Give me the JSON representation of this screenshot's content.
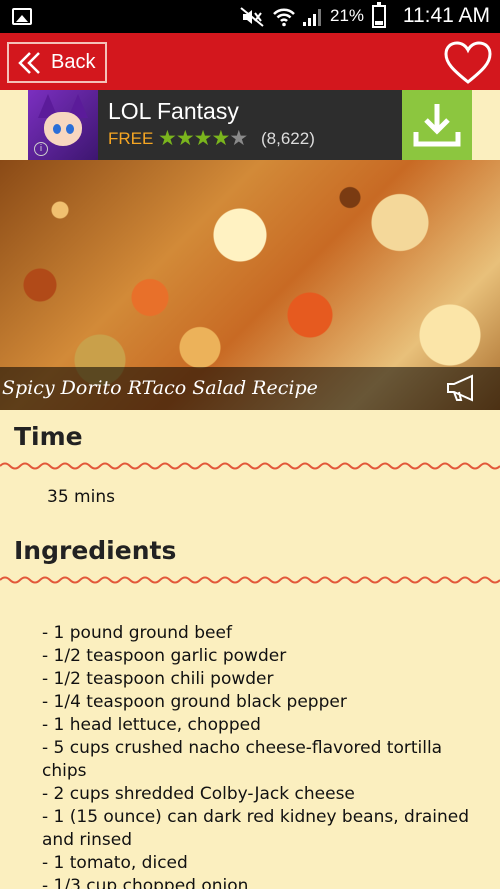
{
  "status_bar": {
    "battery": "21%",
    "time": "11:41 AM"
  },
  "toolbar": {
    "back_label": "Back"
  },
  "ad": {
    "title": "LOL Fantasy",
    "price": "FREE",
    "rating_stars": 4,
    "rating_count": "(8,622)"
  },
  "recipe": {
    "title": "Spicy Dorito RTaco Salad Recipe"
  },
  "time_section": {
    "heading": "Time",
    "value": "35 mins"
  },
  "ingredients_section": {
    "heading": "Ingredients",
    "items": [
      " -  1 pound ground beef",
      " -  1/2 teaspoon garlic powder",
      " -  1/2 teaspoon chili powder",
      " -  1/4 teaspoon ground black pepper",
      " -  1 head lettuce, chopped",
      " -  5 cups crushed nacho cheese-flavored tortilla chips",
      " -  2 cups shredded Colby-Jack cheese",
      " -  1 (15 ounce) can dark red kidney beans, drained and rinsed",
      " -  1 tomato, diced",
      " -  1/3 cup chopped onion"
    ]
  },
  "colors": {
    "toolbar": "#d3171d",
    "background": "#fbefbf",
    "wave": "#e2583a",
    "download": "#8cc63f"
  }
}
